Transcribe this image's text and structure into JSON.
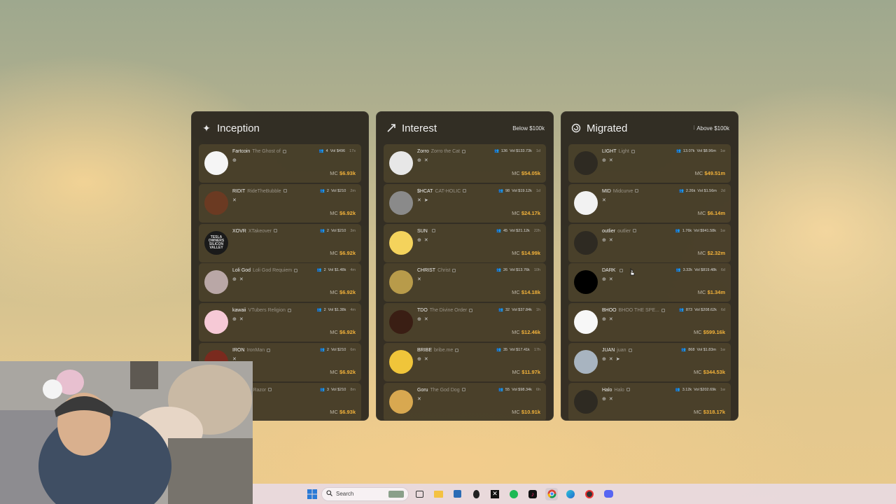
{
  "panels": [
    {
      "title": "Inception",
      "icon": "sparkle-icon",
      "filter": "",
      "rows": [
        {
          "ticker": "Fartcoin",
          "name": "The Ghost of",
          "holders": "4",
          "vol": "Vol $496",
          "age": "17s",
          "mc_label": "MC",
          "mc": "$6.93k",
          "socials": [
            "link"
          ],
          "avatar": "#f5f5f5"
        },
        {
          "ticker": "RIDIT",
          "name": "RideTheBubble",
          "holders": "2",
          "vol": "Vol $210",
          "age": "2m",
          "mc_label": "MC",
          "mc": "$6.92k",
          "socials": [
            "x"
          ],
          "avatar": "#6b3a22"
        },
        {
          "ticker": "XOVR",
          "name": "XTakeover",
          "holders": "2",
          "vol": "Vol $210",
          "age": "3m",
          "mc_label": "MC",
          "mc": "$6.92k",
          "socials": [],
          "avatar": "#1a1a1a",
          "avatar_text": "TESLA OWNERS SILICON VALLEY"
        },
        {
          "ticker": "Loli God",
          "name": "Loli God Requiem",
          "holders": "2",
          "vol": "Vol $1.48k",
          "age": "4m",
          "mc_label": "MC",
          "mc": "$6.92k",
          "socials": [
            "link",
            "x"
          ],
          "avatar": "#b9a7a6"
        },
        {
          "ticker": "kawaii",
          "name": "VTubers Religion",
          "holders": "2",
          "vol": "Vol $1.38k",
          "age": "4m",
          "mc_label": "MC",
          "mc": "$6.92k",
          "socials": [
            "link",
            "x"
          ],
          "avatar": "#f6c9d6"
        },
        {
          "ticker": "IRON",
          "name": "IronMan",
          "holders": "2",
          "vol": "Vol $210",
          "age": "6m",
          "mc_label": "MC",
          "mc": "$6.92k",
          "socials": [
            "x"
          ],
          "avatar": "#7a2a1e"
        },
        {
          "ticker": "",
          "name": "Gremlin Razor",
          "holders": "3",
          "vol": "Vol $210",
          "age": "8m",
          "mc_label": "MC",
          "mc": "$6.93k",
          "socials": [],
          "avatar": "#555"
        }
      ]
    },
    {
      "title": "Interest",
      "icon": "trend-up-icon",
      "filter": "Below $100k",
      "rows": [
        {
          "ticker": "Zorro",
          "name": "Zorro the Cat",
          "holders": "136",
          "vol": "Vol $133.73k",
          "age": "1d",
          "mc_label": "MC",
          "mc": "$54.05k",
          "socials": [
            "link",
            "x"
          ],
          "avatar": "#e7e7e7"
        },
        {
          "ticker": "$HCAT",
          "name": "CAT-HOLIC",
          "holders": "98",
          "vol": "Vol $19.12k",
          "age": "1d",
          "mc_label": "MC",
          "mc": "$24.17k",
          "socials": [
            "x",
            "telegram"
          ],
          "avatar": "#8a8a8a"
        },
        {
          "ticker": "SUN",
          "name": "",
          "holders": "45",
          "vol": "Vol $21.12k",
          "age": "22h",
          "mc_label": "MC",
          "mc": "$14.99k",
          "socials": [
            "link",
            "x"
          ],
          "avatar": "#f4d35c"
        },
        {
          "ticker": "CHRIST",
          "name": "Christ",
          "holders": "26",
          "vol": "Vol $13.76k",
          "age": "10h",
          "mc_label": "MC",
          "mc": "$14.18k",
          "socials": [
            "x"
          ],
          "avatar": "#b89b4a"
        },
        {
          "ticker": "TDO",
          "name": "The Divine Order",
          "holders": "32",
          "vol": "Vol $37.84k",
          "age": "1h",
          "mc_label": "MC",
          "mc": "$12.46k",
          "socials": [
            "link",
            "x"
          ],
          "avatar": "#3a1e14"
        },
        {
          "ticker": "BRIBE",
          "name": "bribe.me",
          "holders": "35",
          "vol": "Vol $17.41k",
          "age": "17h",
          "mc_label": "MC",
          "mc": "$11.97k",
          "socials": [
            "link",
            "x"
          ],
          "avatar": "#f0c53a"
        },
        {
          "ticker": "Goru",
          "name": "The God Dog",
          "holders": "55",
          "vol": "Vol $98.34k",
          "age": "6h",
          "mc_label": "MC",
          "mc": "$10.91k",
          "socials": [
            "x"
          ],
          "avatar": "#d8a850"
        }
      ]
    },
    {
      "title": "Migrated",
      "icon": "spiral-icon",
      "filter": "Above $100k",
      "rows": [
        {
          "ticker": "LIGHT",
          "name": "Light",
          "holders": "13.07k",
          "vol": "Vol $8.96m",
          "age": "1w",
          "mc_label": "MC",
          "mc": "$49.51m",
          "socials": [
            "link",
            "x"
          ],
          "avatar": "#2e2a22"
        },
        {
          "ticker": "MID",
          "name": "Midcurve",
          "holders": "2.26k",
          "vol": "Vol $1.56m",
          "age": "2d",
          "mc_label": "MC",
          "mc": "$6.14m",
          "socials": [
            "x"
          ],
          "avatar": "#f2f2f2"
        },
        {
          "ticker": "outlier",
          "name": "outlier",
          "holders": "1.76k",
          "vol": "Vol $941.58k",
          "age": "1w",
          "mc_label": "MC",
          "mc": "$2.32m",
          "socials": [
            "link",
            "x"
          ],
          "avatar": "#2e2a22"
        },
        {
          "ticker": "DARK",
          "name": "",
          "holders": "3.32k",
          "vol": "Vol $819.48k",
          "age": "6d",
          "mc_label": "MC",
          "mc": "$1.34m",
          "socials": [
            "link",
            "x"
          ],
          "avatar": "#000000"
        },
        {
          "ticker": "BHOO",
          "name": "BHOO THE SPE...",
          "holders": "873",
          "vol": "Vol $208.62k",
          "age": "6d",
          "mc_label": "MC",
          "mc": "$599.16k",
          "socials": [
            "link",
            "x"
          ],
          "avatar": "#f7f7f7"
        },
        {
          "ticker": "JUAN",
          "name": "juan",
          "holders": "868",
          "vol": "Vol $1.83m",
          "age": "1w",
          "mc_label": "MC",
          "mc": "$344.53k",
          "socials": [
            "link",
            "x",
            "telegram"
          ],
          "avatar": "#a8b4c0"
        },
        {
          "ticker": "Halo",
          "name": "Halo",
          "holders": "3.12k",
          "vol": "Vol $202.69k",
          "age": "1w",
          "mc_label": "MC",
          "mc": "$318.17k",
          "socials": [
            "link",
            "x"
          ],
          "avatar": "#2e2a22"
        }
      ]
    }
  ],
  "taskbar": {
    "search_placeholder": "Search",
    "icons": [
      "windows-start-icon",
      "search-icon",
      "task-view-icon",
      "file-explorer-icon",
      "store-icon",
      "alien-app-icon",
      "capcut-icon",
      "spotify-icon",
      "tiktok-icon",
      "chrome-icon",
      "edge-icon",
      "app-icon",
      "discord-icon"
    ]
  }
}
